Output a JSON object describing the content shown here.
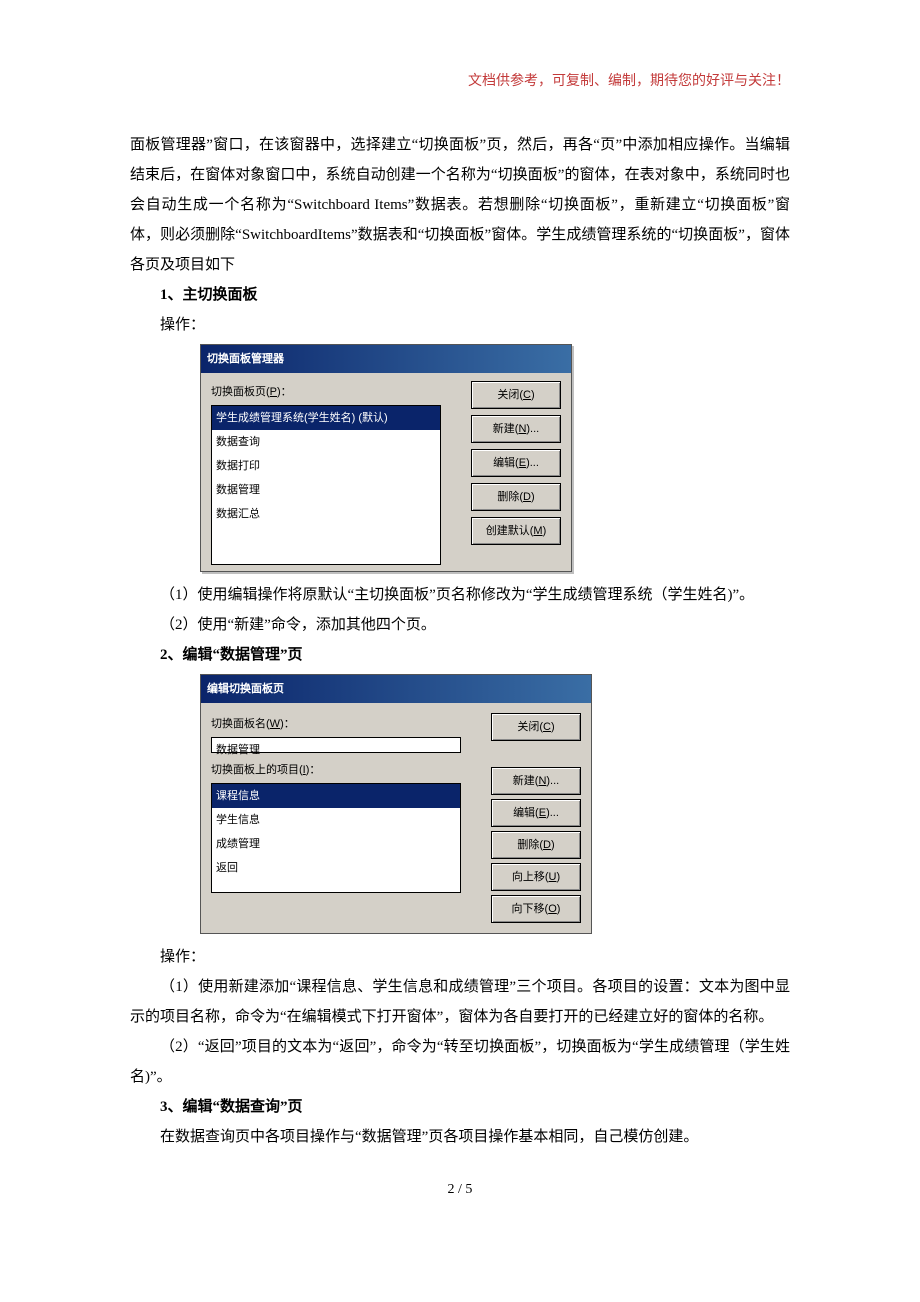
{
  "header": "文档供参考，可复制、编制，期待您的好评与关注！",
  "para1_1": "面板管理器”窗口，在该窗器中，选择建立“切换面板”页，然后，再各“页”中添加相应操作。当编辑结束后，在窗体对象窗口中，系统自动创建一个名称为“切换面板”的窗体，在表对象中，系统同时也会自动生成一个名称为“Switchboard Items”数据表。若想删除“切换面板”，重新建立“切换面板”窗体，则必须删除“SwitchboardItems”数据表和“切换面板”窗体。学生成绩管理系统的“切换面板”，窗体各页及项目如下",
  "h1": "1、主切换面板",
  "op": "操作：",
  "dlg1": {
    "title": "切换面板管理器",
    "lbl_pages": "切换面板页(P)：",
    "items": [
      "学生成绩管理系统(学生姓名)  (默认)",
      "数据查询",
      "数据打印",
      "数据管理",
      "数据汇总"
    ],
    "btn_close": "关闭(C)",
    "btn_new": "新建(N)...",
    "btn_edit": "编辑(E)...",
    "btn_del": "删除(D)",
    "btn_default": "创建默认(M)"
  },
  "para2": "（1）使用编辑操作将原默认“主切换面板”页名称修改为“学生成绩管理系统（学生姓名)”。",
  "para3": "（2）使用“新建”命令，添加其他四个页。",
  "h2": "2、编辑“数据管理”页",
  "dlg2": {
    "title": "编辑切换面板页",
    "lbl_name": "切换面板名(W)：",
    "name_value": "数据管理",
    "lbl_items": "切换面板上的项目(I)：",
    "items": [
      "课程信息",
      "学生信息",
      "成绩管理",
      "返回"
    ],
    "btn_close": "关闭(C)",
    "btn_new": "新建(N)...",
    "btn_edit": "编辑(E)...",
    "btn_del": "删除(D)",
    "btn_up": "向上移(U)",
    "btn_down": "向下移(O)"
  },
  "para4": "操作：",
  "para5": "（1）使用新建添加“课程信息、学生信息和成绩管理”三个项目。各项目的设置：文本为图中显示的项目名称，命令为“在编辑模式下打开窗体”，窗体为各自要打开的已经建立好的窗体的名称。",
  "para6": "（2）“返回”项目的文本为“返回”，命令为“转至切换面板”，切换面板为“学生成绩管理（学生姓名)”。",
  "h3": "3、编辑“数据查询”页",
  "para7": "在数据查询页中各项目操作与“数据管理”页各项目操作基本相同，自己模仿创建。",
  "page": "2 / 5"
}
